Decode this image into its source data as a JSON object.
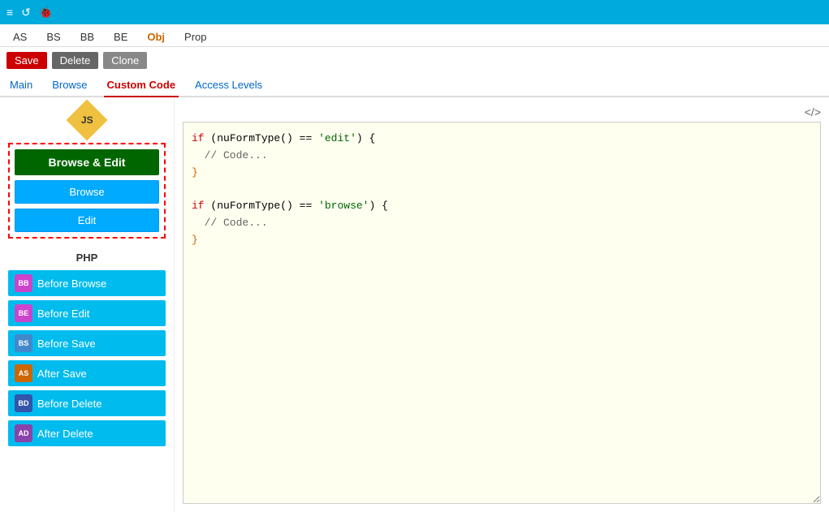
{
  "topbar": {
    "icons": [
      "≡",
      "↺",
      "🐞"
    ]
  },
  "tabs": [
    {
      "label": "AS",
      "active": false
    },
    {
      "label": "BS",
      "active": false
    },
    {
      "label": "BB",
      "active": false
    },
    {
      "label": "BE",
      "active": false
    },
    {
      "label": "Obj",
      "active": false
    },
    {
      "label": "Prop",
      "active": false
    }
  ],
  "toolbar": {
    "save": "Save",
    "delete": "Delete",
    "clone": "Clone"
  },
  "nav_tabs": [
    {
      "label": "Main",
      "active": false
    },
    {
      "label": "Browse",
      "active": false
    },
    {
      "label": "Custom Code",
      "active": true
    },
    {
      "label": "Access Levels",
      "active": false
    }
  ],
  "left_panel": {
    "js_label": "JS",
    "browse_edit_label": "Browse & Edit",
    "browse_label": "Browse",
    "edit_label": "Edit",
    "php_section_label": "PHP",
    "php_buttons": [
      {
        "badge": "BB",
        "label": "Before Browse",
        "badge_class": "badge-bb"
      },
      {
        "badge": "BE",
        "label": "Before Edit",
        "badge_class": "badge-be"
      },
      {
        "badge": "BS",
        "label": "Before Save",
        "badge_class": "badge-bs"
      },
      {
        "badge": "AS",
        "label": "After Save",
        "badge_class": "badge-as"
      },
      {
        "badge": "BD",
        "label": "Before Delete",
        "badge_class": "badge-bd"
      },
      {
        "badge": "AD",
        "label": "After Delete",
        "badge_class": "badge-ad"
      }
    ]
  },
  "code_editor": {
    "toolbar_icon": "</>",
    "code_lines": [
      {
        "text": "if (nuFormType() == 'edit') {",
        "type": "keyword"
      },
      {
        "text": "  // Code...",
        "type": "comment"
      },
      {
        "text": "}",
        "type": "bracket"
      },
      {
        "text": "",
        "type": "plain"
      },
      {
        "text": "if (nuFormType() == 'browse') {",
        "type": "keyword"
      },
      {
        "text": "  // Code...",
        "type": "comment"
      },
      {
        "text": "}",
        "type": "bracket"
      }
    ]
  }
}
